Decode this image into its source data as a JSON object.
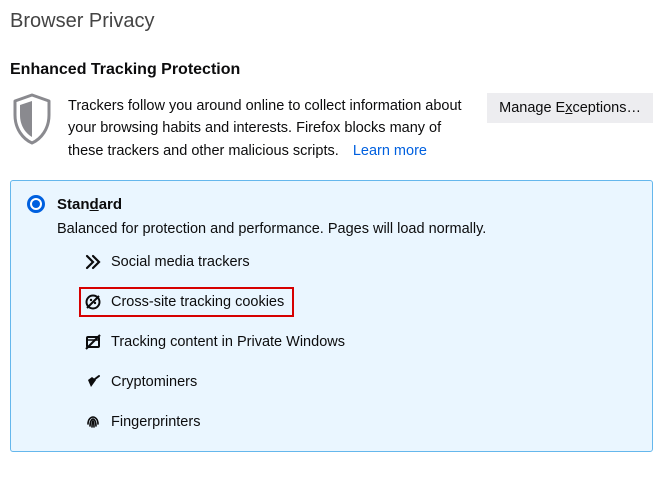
{
  "page_title": "Browser Privacy",
  "section_title": "Enhanced Tracking Protection",
  "intro_text": "Trackers follow you around online to collect information about your browsing habits and interests. Firefox blocks many of these trackers and other malicious scripts.",
  "learn_more_label": "Learn more",
  "manage_exceptions_pre": "Manage E",
  "manage_exceptions_u": "x",
  "manage_exceptions_post": "ceptions…",
  "option": {
    "title_pre": "Stan",
    "title_u": "d",
    "title_post": "ard",
    "description": "Balanced for protection and performance. Pages will load normally.",
    "trackers": [
      {
        "icon": "social-icon",
        "label": "Social media trackers",
        "highlight": false
      },
      {
        "icon": "cookie-icon",
        "label": "Cross-site tracking cookies",
        "highlight": true
      },
      {
        "icon": "private-icon",
        "label": "Tracking content in Private Windows",
        "highlight": false
      },
      {
        "icon": "cryptominer-icon",
        "label": "Cryptominers",
        "highlight": false
      },
      {
        "icon": "fingerprint-icon",
        "label": "Fingerprinters",
        "highlight": false
      }
    ]
  }
}
